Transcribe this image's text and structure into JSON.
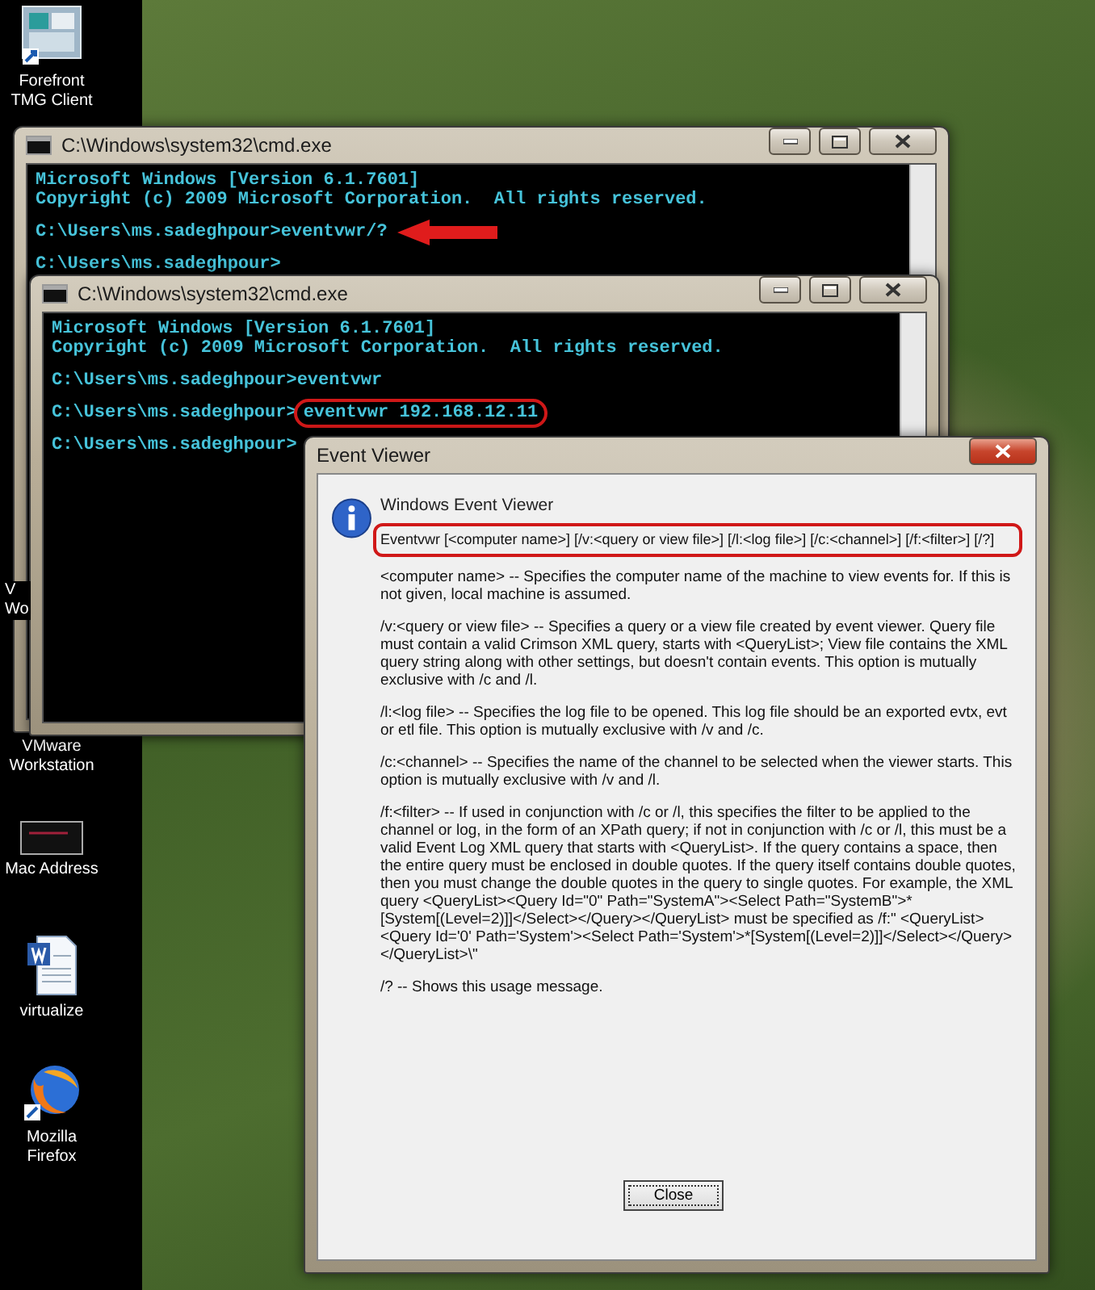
{
  "desktop_icons": [
    {
      "kind": "app",
      "lines": [
        "Forefront",
        "TMG Client"
      ]
    },
    {
      "kind": "covered",
      "lines": [
        "V",
        "Wo"
      ]
    },
    {
      "kind": "vmware",
      "lines": [
        "VMware",
        "Workstation"
      ]
    },
    {
      "kind": "terminal",
      "lines": [
        "Mac Address"
      ]
    },
    {
      "kind": "document",
      "lines": [
        "virtualize"
      ]
    },
    {
      "kind": "browser",
      "lines": [
        "Mozilla",
        "Firefox"
      ]
    }
  ],
  "console_windows": [
    {
      "title": "C:\\Windows\\system32\\cmd.exe",
      "lines": [
        {
          "kind": "output",
          "text": "Microsoft Windows [Version 6.1.7601]"
        },
        {
          "kind": "output",
          "text": "Copyright (c) 2009 Microsoft Corporation.  All rights reserved."
        },
        {
          "kind": "prompt",
          "prompt": "C:\\Users\\ms.sadeghpour>",
          "command": "eventvwr/?",
          "arrow": true
        },
        {
          "kind": "prompt",
          "prompt": "C:\\Users\\ms.sadeghpour>"
        }
      ]
    },
    {
      "title": "C:\\Windows\\system32\\cmd.exe",
      "lines": [
        {
          "kind": "output",
          "text": "Microsoft Windows [Version 6.1.7601]"
        },
        {
          "kind": "output",
          "text": "Copyright (c) 2009 Microsoft Corporation.  All rights reserved."
        },
        {
          "kind": "prompt",
          "prompt": "C:\\Users\\ms.sadeghpour>",
          "command": "eventvwr"
        },
        {
          "kind": "prompt",
          "prompt": "C:\\Users\\ms.sadeghpour>",
          "command": "eventvwr 192.168.12.11",
          "circled": true
        },
        {
          "kind": "prompt",
          "prompt": "C:\\Users\\ms.sadeghpour>"
        }
      ]
    }
  ],
  "dialog": {
    "title": "Event Viewer",
    "heading": "Windows Event Viewer",
    "usage": "Eventvwr [<computer name>] [/v:<query or view file>] [/l:<log file>] [/c:<channel>] [/f:<filter>] [/?]",
    "usage_highlighted": true,
    "paragraphs": [
      "<computer name> -- Specifies the computer name of the machine to view events for. If this is not given, local machine is assumed.",
      "/v:<query or view file> -- Specifies a query or a view file created by event viewer. Query file must contain a valid Crimson XML query, starts with <QueryList>; View file contains the XML query string along with other settings, but doesn't contain events. This option is mutually exclusive with /c and /l.",
      "/l:<log file> -- Specifies the log file to be opened. This log file should be an exported evtx, evt or etl file. This option is mutually exclusive with /v and /c.",
      "/c:<channel> -- Specifies the name of the channel to be selected when the viewer starts. This option is mutually exclusive with /v and /l.",
      "/f:<filter> -- If used in conjunction with /c or /l, this specifies the filter to be applied to the channel or log, in the form of an XPath query; if not in conjunction with /c or /l, this must be a valid Event Log XML query that starts with <QueryList>. If the query contains a space, then the entire query must be enclosed in double quotes. If the query itself contains double quotes, then you must change the double quotes in the query to single quotes. For example, the XML query <QueryList><Query Id=\"0\" Path=\"SystemA\"><Select Path=\"SystemB\">*[System[(Level=2)]]</Select></Query></QueryList> must be specified as /f:\" <QueryList><Query Id='0' Path='System'><Select Path='System'>*[System[(Level=2)]]</Select></Query></QueryList>\\\"",
      "/? -- Shows this usage message."
    ],
    "button": "Close"
  }
}
